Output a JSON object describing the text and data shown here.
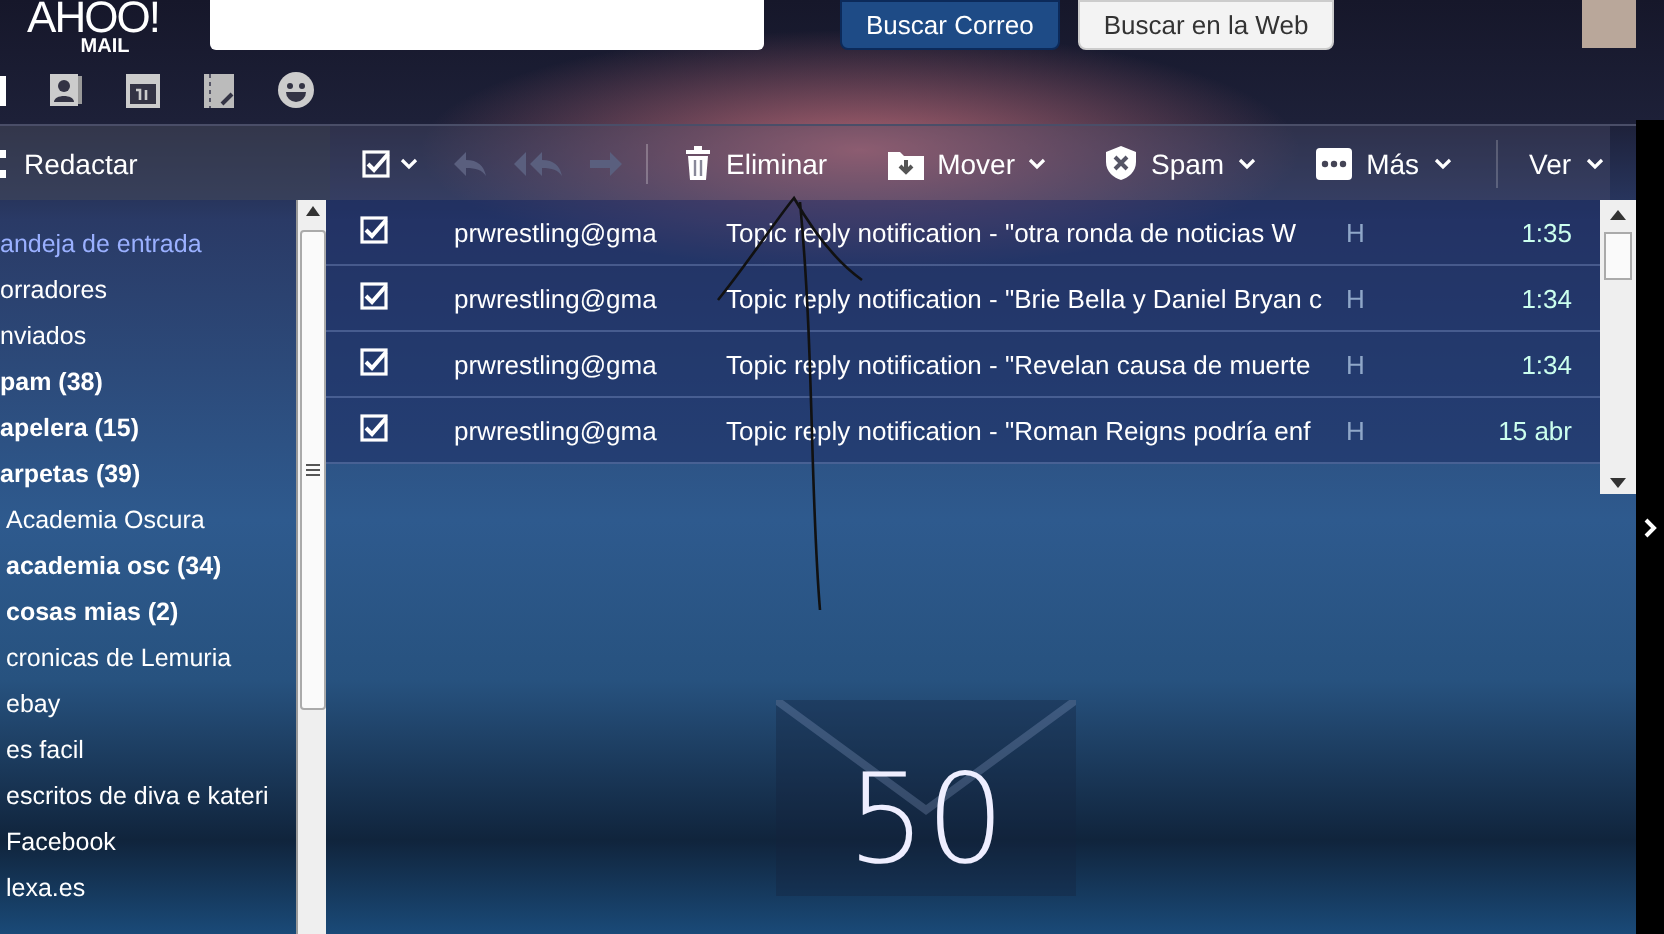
{
  "header": {
    "logo": "AHOO!",
    "logo_sub": "MAIL",
    "search_buttons": [
      {
        "label": "Buscar Correo",
        "kind": "primary"
      },
      {
        "label": "Buscar en la Web",
        "kind": "secondary"
      }
    ]
  },
  "compose": "Redactar",
  "toolbar": {
    "select_all_checked": true,
    "actions": [
      {
        "label": "Eliminar",
        "kind": "delete"
      },
      {
        "label": "Mover",
        "kind": "move"
      },
      {
        "label": "Spam",
        "kind": "spam"
      },
      {
        "label": "Más",
        "kind": "more"
      },
      {
        "label": "Ver",
        "kind": "view"
      }
    ]
  },
  "folders": [
    {
      "label": "andeja de entrada",
      "selected": true,
      "bold": false
    },
    {
      "label": "orradores",
      "selected": false,
      "bold": false
    },
    {
      "label": "nviados",
      "selected": false,
      "bold": false
    },
    {
      "label": "pam (38)",
      "selected": false,
      "bold": true
    },
    {
      "label": "apelera (15)",
      "selected": false,
      "bold": true
    },
    {
      "label": "arpetas (39)",
      "selected": false,
      "bold": true,
      "children": [
        {
          "label": "Academia Oscura",
          "selected": false,
          "bold": false
        },
        {
          "label": "academia osc (34)",
          "selected": false,
          "bold": true
        },
        {
          "label": "cosas mias (2)",
          "selected": false,
          "bold": true
        },
        {
          "label": "cronicas de Lemuria",
          "selected": false,
          "bold": false
        },
        {
          "label": "ebay",
          "selected": false,
          "bold": false
        },
        {
          "label": "es facil",
          "selected": false,
          "bold": false
        },
        {
          "label": "escritos de diva e kateri",
          "selected": false,
          "bold": false
        },
        {
          "label": "Facebook",
          "selected": false,
          "bold": false
        },
        {
          "label": "lexa.es",
          "selected": false,
          "bold": false
        }
      ]
    }
  ],
  "messages": [
    {
      "checked": true,
      "sender": "prwrestling@gma",
      "subject": "Topic reply notification - \"otra ronda de noticias W",
      "column_3": "H",
      "time": "1:35"
    },
    {
      "checked": true,
      "sender": "prwrestling@gma",
      "subject": "Topic reply notification - \"Brie Bella y Daniel Bryan c",
      "column_3": "H",
      "time": "1:34"
    },
    {
      "checked": true,
      "sender": "prwrestling@gma",
      "subject": "Topic reply notification - \"Revelan causa de muerte",
      "column_3": "H",
      "time": "1:34"
    },
    {
      "checked": true,
      "sender": "prwrestling@gma",
      "subject": "Topic reply notification - \"Roman Reigns podría enf",
      "column_3": "H",
      "time": "15 abr"
    }
  ],
  "unread_counter": "50"
}
